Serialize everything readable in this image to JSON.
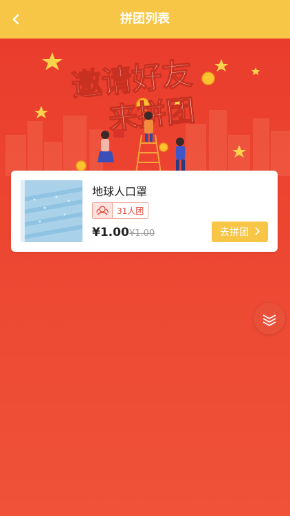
{
  "header": {
    "title": "拼团列表",
    "back_icon": "chevron-left-icon"
  },
  "banner": {
    "line1": "邀请好友",
    "line2": "来拼团"
  },
  "items": [
    {
      "name": "地球人口罩",
      "tag": "31人团",
      "price": "¥1.00",
      "original_price": "¥1.00",
      "button_label": "去拼团",
      "button_icon": "chevron-right-icon"
    }
  ],
  "float_button": {
    "icon": "layers-icon"
  },
  "colors": {
    "header": "#f8c646",
    "background": "#ec4430",
    "accent": "#e44a3a",
    "button": "#f8c646"
  }
}
